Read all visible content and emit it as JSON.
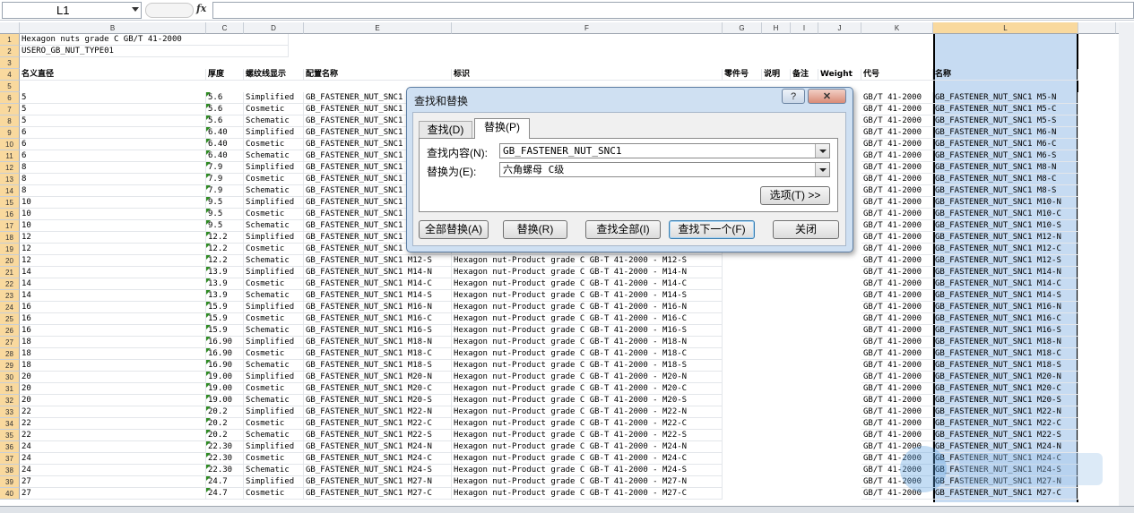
{
  "formula_bar": {
    "name_box": "L1",
    "fx": "fx",
    "formula": ""
  },
  "columns": [
    "B",
    "C",
    "D",
    "E",
    "F",
    "G",
    "H",
    "I",
    "J",
    "K",
    "L"
  ],
  "header_cells": {
    "row1": "Hexagon nuts grade C GB/T 41-2000",
    "row2": "USERO_GB_NUT_TYPE01",
    "row4": [
      "名义直径",
      "厚度",
      "螺纹线显示",
      "配置名称",
      "标识",
      "零件号",
      "说明",
      "备注",
      "Weight",
      "代号",
      "名称"
    ]
  },
  "rows": [
    {
      "n": "6",
      "d": "5",
      "t": "5.6",
      "s": "Simplified",
      "cfg": "GB_FASTENER_NUT_SNC1 M5-N",
      "id": "",
      "code": "GB/T 41-2000",
      "name": "GB_FASTENER_NUT_SNC1 M5-N"
    },
    {
      "n": "7",
      "d": "5",
      "t": "5.6",
      "s": "Cosmetic",
      "cfg": "GB_FASTENER_NUT_SNC1 M5-C",
      "id": "",
      "code": "GB/T 41-2000",
      "name": "GB_FASTENER_NUT_SNC1 M5-C"
    },
    {
      "n": "8",
      "d": "5",
      "t": "5.6",
      "s": "Schematic",
      "cfg": "GB_FASTENER_NUT_SNC1 M5-S",
      "id": "",
      "code": "GB/T 41-2000",
      "name": "GB_FASTENER_NUT_SNC1 M5-S"
    },
    {
      "n": "9",
      "d": "6",
      "t": "6.40",
      "s": "Simplified",
      "cfg": "GB_FASTENER_NUT_SNC1 M6-N",
      "id": "",
      "code": "GB/T 41-2000",
      "name": "GB_FASTENER_NUT_SNC1 M6-N"
    },
    {
      "n": "10",
      "d": "6",
      "t": "6.40",
      "s": "Cosmetic",
      "cfg": "GB_FASTENER_NUT_SNC1 M6-C",
      "id": "",
      "code": "GB/T 41-2000",
      "name": "GB_FASTENER_NUT_SNC1 M6-C"
    },
    {
      "n": "11",
      "d": "6",
      "t": "6.40",
      "s": "Schematic",
      "cfg": "GB_FASTENER_NUT_SNC1 M6-S",
      "id": "",
      "code": "GB/T 41-2000",
      "name": "GB_FASTENER_NUT_SNC1 M6-S"
    },
    {
      "n": "12",
      "d": "8",
      "t": "7.9",
      "s": "Simplified",
      "cfg": "GB_FASTENER_NUT_SNC1 M8-N",
      "id": "",
      "code": "GB/T 41-2000",
      "name": "GB_FASTENER_NUT_SNC1 M8-N"
    },
    {
      "n": "13",
      "d": "8",
      "t": "7.9",
      "s": "Cosmetic",
      "cfg": "GB_FASTENER_NUT_SNC1 M8-C",
      "id": "",
      "code": "GB/T 41-2000",
      "name": "GB_FASTENER_NUT_SNC1 M8-C"
    },
    {
      "n": "14",
      "d": "8",
      "t": "7.9",
      "s": "Schematic",
      "cfg": "GB_FASTENER_NUT_SNC1 M8-S",
      "id": "",
      "code": "GB/T 41-2000",
      "name": "GB_FASTENER_NUT_SNC1 M8-S"
    },
    {
      "n": "15",
      "d": "10",
      "t": "9.5",
      "s": "Simplified",
      "cfg": "GB_FASTENER_NUT_SNC1 M10-N",
      "id": "",
      "code": "GB/T 41-2000",
      "name": "GB_FASTENER_NUT_SNC1 M10-N"
    },
    {
      "n": "16",
      "d": "10",
      "t": "9.5",
      "s": "Cosmetic",
      "cfg": "GB_FASTENER_NUT_SNC1 M10-C",
      "id": "",
      "code": "GB/T 41-2000",
      "name": "GB_FASTENER_NUT_SNC1 M10-C"
    },
    {
      "n": "17",
      "d": "10",
      "t": "9.5",
      "s": "Schematic",
      "cfg": "GB_FASTENER_NUT_SNC1 M10-S",
      "id": "",
      "code": "GB/T 41-2000",
      "name": "GB_FASTENER_NUT_SNC1 M10-S"
    },
    {
      "n": "18",
      "d": "12",
      "t": "12.2",
      "s": "Simplified",
      "cfg": "GB_FASTENER_NUT_SNC1 M12-N",
      "id": "",
      "code": "GB/T 41-2000",
      "name": "GB_FASTENER_NUT_SNC1 M12-N"
    },
    {
      "n": "19",
      "d": "12",
      "t": "12.2",
      "s": "Cosmetic",
      "cfg": "GB_FASTENER_NUT_SNC1 M12-C",
      "id": "Hexagon nut-Product grade C GB-T 41-2000 - M12-C",
      "code": "GB/T 41-2000",
      "name": "GB_FASTENER_NUT_SNC1 M12-C"
    },
    {
      "n": "20",
      "d": "12",
      "t": "12.2",
      "s": "Schematic",
      "cfg": "GB_FASTENER_NUT_SNC1 M12-S",
      "id": "Hexagon nut-Product grade C GB-T 41-2000 - M12-S",
      "code": "GB/T 41-2000",
      "name": "GB_FASTENER_NUT_SNC1 M12-S"
    },
    {
      "n": "21",
      "d": "14",
      "t": "13.9",
      "s": "Simplified",
      "cfg": "GB_FASTENER_NUT_SNC1 M14-N",
      "id": "Hexagon nut-Product grade C GB-T 41-2000 - M14-N",
      "code": "GB/T 41-2000",
      "name": "GB_FASTENER_NUT_SNC1 M14-N"
    },
    {
      "n": "22",
      "d": "14",
      "t": "13.9",
      "s": "Cosmetic",
      "cfg": "GB_FASTENER_NUT_SNC1 M14-C",
      "id": "Hexagon nut-Product grade C GB-T 41-2000 - M14-C",
      "code": "GB/T 41-2000",
      "name": "GB_FASTENER_NUT_SNC1 M14-C"
    },
    {
      "n": "23",
      "d": "14",
      "t": "13.9",
      "s": "Schematic",
      "cfg": "GB_FASTENER_NUT_SNC1 M14-S",
      "id": "Hexagon nut-Product grade C GB-T 41-2000 - M14-S",
      "code": "GB/T 41-2000",
      "name": "GB_FASTENER_NUT_SNC1 M14-S"
    },
    {
      "n": "24",
      "d": "16",
      "t": "15.9",
      "s": "Simplified",
      "cfg": "GB_FASTENER_NUT_SNC1 M16-N",
      "id": "Hexagon nut-Product grade C GB-T 41-2000 - M16-N",
      "code": "GB/T 41-2000",
      "name": "GB_FASTENER_NUT_SNC1 M16-N"
    },
    {
      "n": "25",
      "d": "16",
      "t": "15.9",
      "s": "Cosmetic",
      "cfg": "GB_FASTENER_NUT_SNC1 M16-C",
      "id": "Hexagon nut-Product grade C GB-T 41-2000 - M16-C",
      "code": "GB/T 41-2000",
      "name": "GB_FASTENER_NUT_SNC1 M16-C"
    },
    {
      "n": "26",
      "d": "16",
      "t": "15.9",
      "s": "Schematic",
      "cfg": "GB_FASTENER_NUT_SNC1 M16-S",
      "id": "Hexagon nut-Product grade C GB-T 41-2000 - M16-S",
      "code": "GB/T 41-2000",
      "name": "GB_FASTENER_NUT_SNC1 M16-S"
    },
    {
      "n": "27",
      "d": "18",
      "t": "16.90",
      "s": "Simplified",
      "cfg": "GB_FASTENER_NUT_SNC1 M18-N",
      "id": "Hexagon nut-Product grade C GB-T 41-2000 - M18-N",
      "code": "GB/T 41-2000",
      "name": "GB_FASTENER_NUT_SNC1 M18-N"
    },
    {
      "n": "28",
      "d": "18",
      "t": "16.90",
      "s": "Cosmetic",
      "cfg": "GB_FASTENER_NUT_SNC1 M18-C",
      "id": "Hexagon nut-Product grade C GB-T 41-2000 - M18-C",
      "code": "GB/T 41-2000",
      "name": "GB_FASTENER_NUT_SNC1 M18-C"
    },
    {
      "n": "29",
      "d": "18",
      "t": "16.90",
      "s": "Schematic",
      "cfg": "GB_FASTENER_NUT_SNC1 M18-S",
      "id": "Hexagon nut-Product grade C GB-T 41-2000 - M18-S",
      "code": "GB/T 41-2000",
      "name": "GB_FASTENER_NUT_SNC1 M18-S"
    },
    {
      "n": "30",
      "d": "20",
      "t": "19.00",
      "s": "Simplified",
      "cfg": "GB_FASTENER_NUT_SNC1 M20-N",
      "id": "Hexagon nut-Product grade C GB-T 41-2000 - M20-N",
      "code": "GB/T 41-2000",
      "name": "GB_FASTENER_NUT_SNC1 M20-N"
    },
    {
      "n": "31",
      "d": "20",
      "t": "19.00",
      "s": "Cosmetic",
      "cfg": "GB_FASTENER_NUT_SNC1 M20-C",
      "id": "Hexagon nut-Product grade C GB-T 41-2000 - M20-C",
      "code": "GB/T 41-2000",
      "name": "GB_FASTENER_NUT_SNC1 M20-C"
    },
    {
      "n": "32",
      "d": "20",
      "t": "19.00",
      "s": "Schematic",
      "cfg": "GB_FASTENER_NUT_SNC1 M20-S",
      "id": "Hexagon nut-Product grade C GB-T 41-2000 - M20-S",
      "code": "GB/T 41-2000",
      "name": "GB_FASTENER_NUT_SNC1 M20-S"
    },
    {
      "n": "33",
      "d": "22",
      "t": "20.2",
      "s": "Simplified",
      "cfg": "GB_FASTENER_NUT_SNC1 M22-N",
      "id": "Hexagon nut-Product grade C GB-T 41-2000 - M22-N",
      "code": "GB/T 41-2000",
      "name": "GB_FASTENER_NUT_SNC1 M22-N"
    },
    {
      "n": "34",
      "d": "22",
      "t": "20.2",
      "s": "Cosmetic",
      "cfg": "GB_FASTENER_NUT_SNC1 M22-C",
      "id": "Hexagon nut-Product grade C GB-T 41-2000 - M22-C",
      "code": "GB/T 41-2000",
      "name": "GB_FASTENER_NUT_SNC1 M22-C"
    },
    {
      "n": "35",
      "d": "22",
      "t": "20.2",
      "s": "Schematic",
      "cfg": "GB_FASTENER_NUT_SNC1 M22-S",
      "id": "Hexagon nut-Product grade C GB-T 41-2000 - M22-S",
      "code": "GB/T 41-2000",
      "name": "GB_FASTENER_NUT_SNC1 M22-S"
    },
    {
      "n": "36",
      "d": "24",
      "t": "22.30",
      "s": "Simplified",
      "cfg": "GB_FASTENER_NUT_SNC1 M24-N",
      "id": "Hexagon nut-Product grade C GB-T 41-2000 - M24-N",
      "code": "GB/T 41-2000",
      "name": "GB_FASTENER_NUT_SNC1 M24-N"
    },
    {
      "n": "37",
      "d": "24",
      "t": "22.30",
      "s": "Cosmetic",
      "cfg": "GB_FASTENER_NUT_SNC1 M24-C",
      "id": "Hexagon nut-Product grade C GB-T 41-2000 - M24-C",
      "code": "GB/T 41-2000",
      "name": "GB_FASTENER_NUT_SNC1 M24-C"
    },
    {
      "n": "38",
      "d": "24",
      "t": "22.30",
      "s": "Schematic",
      "cfg": "GB_FASTENER_NUT_SNC1 M24-S",
      "id": "Hexagon nut-Product grade C GB-T 41-2000 - M24-S",
      "code": "GB/T 41-2000",
      "name": "GB_FASTENER_NUT_SNC1 M24-S"
    },
    {
      "n": "39",
      "d": "27",
      "t": "24.7",
      "s": "Simplified",
      "cfg": "GB_FASTENER_NUT_SNC1 M27-N",
      "id": "Hexagon nut-Product grade C GB-T 41-2000 - M27-N",
      "code": "GB/T 41-2000",
      "name": "GB_FASTENER_NUT_SNC1 M27-N"
    },
    {
      "n": "40",
      "d": "27",
      "t": "24.7",
      "s": "Cosmetic",
      "cfg": "GB_FASTENER_NUT_SNC1 M27-C",
      "id": "Hexagon nut-Product grade C GB-T 41-2000 - M27-C",
      "code": "GB/T 41-2000",
      "name": "GB_FASTENER_NUT_SNC1 M27-C"
    }
  ],
  "dialog": {
    "title": "查找和替换",
    "help": "?",
    "close_x": "✕",
    "tab_find": "查找(D)",
    "tab_replace": "替换(P)",
    "find_label": "查找内容(N):",
    "find_value": "GB_FASTENER_NUT_SNC1",
    "replace_label": "替换为(E):",
    "replace_value": "六角螺母 C级",
    "options_button": "选项(T) >>",
    "replace_all_button": "全部替换(A)",
    "replace_button": "替换(R)",
    "find_all_button": "查找全部(I)",
    "find_next_button": "查找下一个(F)",
    "close_button": "关闭"
  },
  "colors": {
    "selection": "#c6dbf2",
    "header_highlight": "#f9d99e",
    "dialog_frame": "#cfe0f2"
  }
}
